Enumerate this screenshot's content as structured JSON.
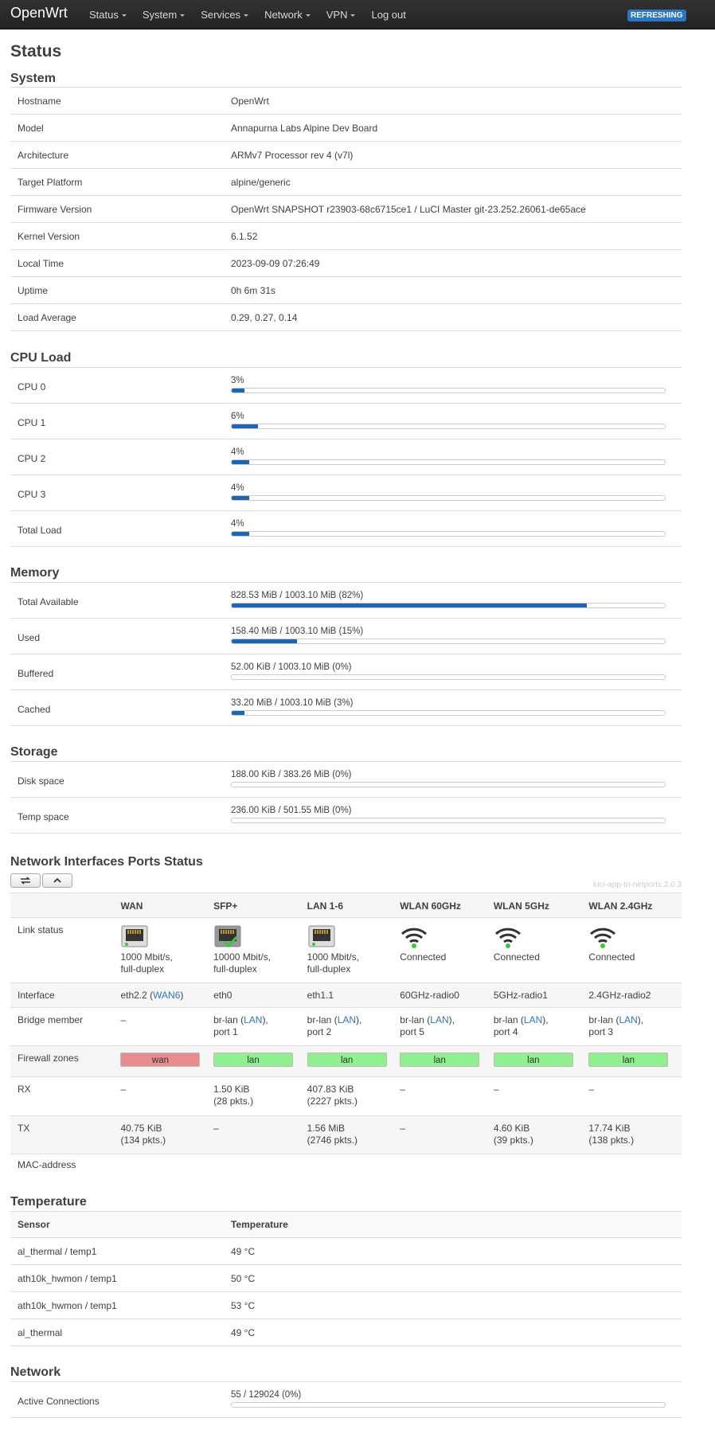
{
  "brand": "OpenWrt",
  "menu": [
    "Status",
    "System",
    "Services",
    "Network",
    "VPN",
    "Log out"
  ],
  "refreshing": "REFRESHING",
  "page_title": "Status",
  "system": {
    "title": "System",
    "rows": [
      {
        "k": "Hostname",
        "v": "OpenWrt"
      },
      {
        "k": "Model",
        "v": "Annapurna Labs Alpine Dev Board"
      },
      {
        "k": "Architecture",
        "v": "ARMv7 Processor rev 4 (v7l)"
      },
      {
        "k": "Target Platform",
        "v": "alpine/generic"
      },
      {
        "k": "Firmware Version",
        "v": "OpenWrt SNAPSHOT r23903-68c6715ce1 / LuCI Master git-23.252.26061-de65ace"
      },
      {
        "k": "Kernel Version",
        "v": "6.1.52"
      },
      {
        "k": "Local Time",
        "v": "2023-09-09 07:26:49"
      },
      {
        "k": "Uptime",
        "v": "0h 6m 31s"
      },
      {
        "k": "Load Average",
        "v": "0.29, 0.27, 0.14"
      }
    ]
  },
  "cpu": {
    "title": "CPU Load",
    "rows": [
      {
        "k": "CPU 0",
        "label": "3%",
        "pct": 3
      },
      {
        "k": "CPU 1",
        "label": "6%",
        "pct": 6
      },
      {
        "k": "CPU 2",
        "label": "4%",
        "pct": 4
      },
      {
        "k": "CPU 3",
        "label": "4%",
        "pct": 4
      },
      {
        "k": "Total Load",
        "label": "4%",
        "pct": 4
      }
    ]
  },
  "memory": {
    "title": "Memory",
    "rows": [
      {
        "k": "Total Available",
        "label": "828.53 MiB / 1003.10 MiB (82%)",
        "pct": 82
      },
      {
        "k": "Used",
        "label": "158.40 MiB / 1003.10 MiB (15%)",
        "pct": 15
      },
      {
        "k": "Buffered",
        "label": "52.00 KiB / 1003.10 MiB (0%)",
        "pct": 0
      },
      {
        "k": "Cached",
        "label": "33.20 MiB / 1003.10 MiB (3%)",
        "pct": 3
      }
    ]
  },
  "storage": {
    "title": "Storage",
    "rows": [
      {
        "k": "Disk space",
        "label": "188.00 KiB / 383.26 MiB (0%)",
        "pct": 0
      },
      {
        "k": "Temp space",
        "label": "236.00 KiB / 501.55 MiB (0%)",
        "pct": 0
      }
    ]
  },
  "ports": {
    "title": "Network Interfaces Ports Status",
    "version": "luci-app-tn-netports 2.0.3",
    "columns": [
      "WAN",
      "SFP+",
      "LAN 1-6",
      "WLAN 60GHz",
      "WLAN 5GHz",
      "WLAN 2.4GHz"
    ],
    "link_status_label": "Link status",
    "link_status": [
      "1000 Mbit/s, full-duplex",
      "10000 Mbit/s, full-duplex",
      "1000 Mbit/s, full-duplex",
      "Connected",
      "Connected",
      "Connected"
    ],
    "icons": [
      "ethernet-port-icon",
      "sfp-port-icon",
      "ethernet-port-icon",
      "wifi-icon",
      "wifi-icon",
      "wifi-icon"
    ],
    "interface_label": "Interface",
    "interfaces": [
      {
        "name": "eth2.2",
        "link": "WAN6"
      },
      {
        "name": "eth0",
        "link": ""
      },
      {
        "name": "eth1.1",
        "link": ""
      },
      {
        "name": "60GHz-radio0",
        "link": ""
      },
      {
        "name": "5GHz-radio1",
        "link": ""
      },
      {
        "name": "2.4GHz-radio2",
        "link": ""
      }
    ],
    "bridge_label": "Bridge member",
    "bridge": [
      {
        "pre": "–",
        "link": "",
        "port": ""
      },
      {
        "pre": "br-lan",
        "link": "LAN",
        "port": "port 1"
      },
      {
        "pre": "br-lan",
        "link": "LAN",
        "port": "port 2"
      },
      {
        "pre": "br-lan",
        "link": "LAN",
        "port": "port 5"
      },
      {
        "pre": "br-lan",
        "link": "LAN",
        "port": "port 4"
      },
      {
        "pre": "br-lan",
        "link": "LAN",
        "port": "port 3"
      }
    ],
    "zones_label": "Firewall zones",
    "zones": [
      "wan",
      "lan",
      "lan",
      "lan",
      "lan",
      "lan"
    ],
    "rx_label": "RX",
    "rx": [
      {
        "a": "–",
        "b": ""
      },
      {
        "a": "1.50 KiB",
        "b": "(28 pkts.)"
      },
      {
        "a": "407.83 KiB",
        "b": "(2227 pkts.)"
      },
      {
        "a": "–",
        "b": ""
      },
      {
        "a": "–",
        "b": ""
      },
      {
        "a": "–",
        "b": ""
      }
    ],
    "tx_label": "TX",
    "tx": [
      {
        "a": "40.75 KiB",
        "b": "(134 pkts.)"
      },
      {
        "a": "–",
        "b": ""
      },
      {
        "a": "1.56 MiB",
        "b": "(2746 pkts.)"
      },
      {
        "a": "–",
        "b": ""
      },
      {
        "a": "4.60 KiB",
        "b": "(39 pkts.)"
      },
      {
        "a": "17.74 KiB",
        "b": "(138 pkts.)"
      }
    ],
    "mac_label": "MAC-address"
  },
  "temperature": {
    "title": "Temperature",
    "head": {
      "k": "Sensor",
      "v": "Temperature"
    },
    "rows": [
      {
        "k": "al_thermal / temp1",
        "v": "49 °C"
      },
      {
        "k": "ath10k_hwmon / temp1",
        "v": "50 °C"
      },
      {
        "k": "ath10k_hwmon / temp1",
        "v": "53 °C"
      },
      {
        "k": "al_thermal",
        "v": "49 °C"
      }
    ]
  },
  "network": {
    "title": "Network",
    "rows": [
      {
        "k": "Active Connections",
        "label": "55 / 129024 (0%)",
        "pct": 0
      }
    ]
  },
  "colors": {
    "accent": "#1e65b3",
    "link": "#2b75c3",
    "zone_wan": "#e88d8d",
    "zone_lan": "#90f090"
  }
}
